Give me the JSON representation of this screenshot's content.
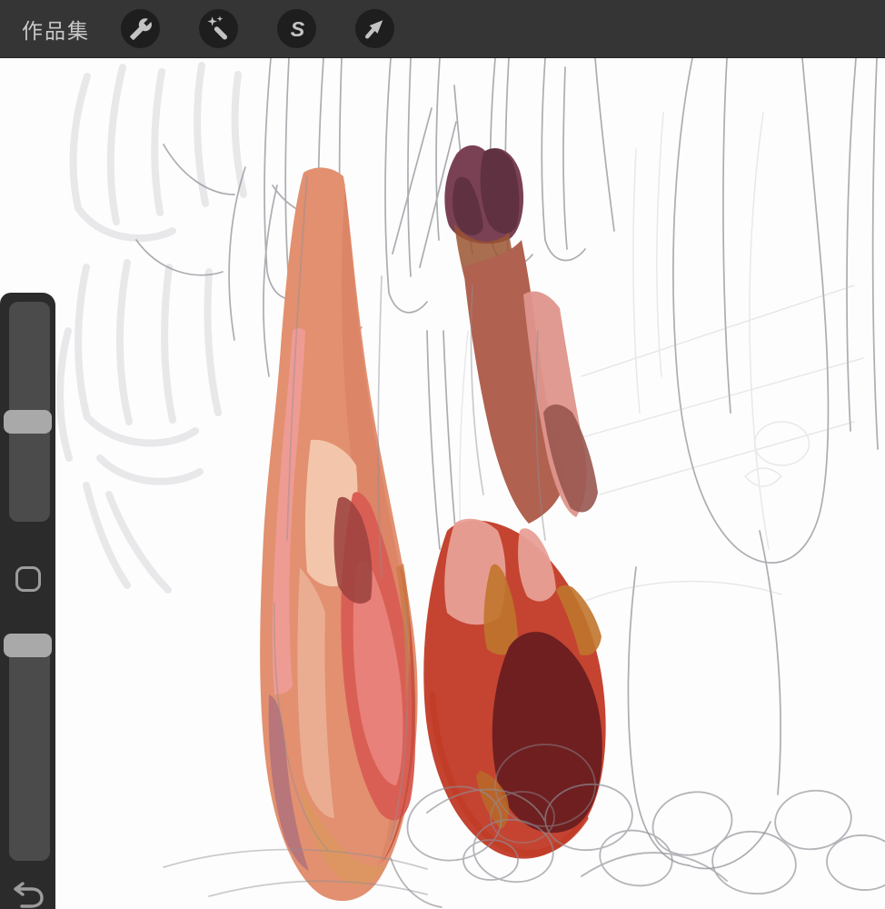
{
  "toolbar": {
    "gallery_label": "作品集",
    "selection_glyph": "S",
    "buttons": [
      {
        "name": "actions",
        "icon": "wrench-icon"
      },
      {
        "name": "adjustments",
        "icon": "magic-wand-icon"
      },
      {
        "name": "selection",
        "icon": "selection-s-icon"
      },
      {
        "name": "transform",
        "icon": "transform-arrow-icon"
      }
    ],
    "colors": {
      "bg": "#353536",
      "button_bg": "#1e1e1e",
      "icon": "#c3c3c3",
      "label": "#c9c9c9"
    }
  },
  "sidebar": {
    "sliders": [
      {
        "name": "brush-size",
        "handle_position_percent_from_top": 55
      },
      {
        "name": "opacity",
        "handle_position_percent_from_top": 0
      }
    ],
    "undo": {
      "icon": "undo-arrow-icon"
    },
    "modify": {
      "icon": "rounded-square-icon"
    },
    "colors": {
      "bg": "#2b2b2c",
      "track": "#4b4b4b",
      "handle": "#a9a9a9",
      "control": "#9c9c9c"
    }
  },
  "canvas": {
    "description": "Digital painting study of two hanging fuchsia flower buds — left bud salmon and coral with red core, right bud deep red with plum cap and dark maroon shadow — over a loose graphite pencil sketch of petals, hanging buds and scribbled loops",
    "background": "#fdfdfd",
    "palette": {
      "pencil": "#8e8e96",
      "pencil_soft": "#a8a8b0",
      "pencil_faint": "#b9b9c1",
      "bud1_base": "#e29070",
      "bud1_shade": "#d87f61",
      "bud1_pink": "#ef9c98",
      "bud1_highlight": "#f3c9ae",
      "bud1_highlight2": "#eeb9a0",
      "bud1_red": "#d95f55",
      "bud1_red_light": "#e8857d",
      "bud1_dark": "#9e4440",
      "bud1_edge": "#c14f3b",
      "bud1_orange": "#cd7a45",
      "bud1_mauve": "#a96e7e",
      "bud1_orange_bottom": "#dd9761",
      "bud2_plum": "#7a4154",
      "bud2_plum_dark": "#5d303f",
      "bud2_rust": "#9a5331",
      "bud2_neck": "#b06150",
      "bud2_pink": "#de958b",
      "bud2_mauve": "#98564f",
      "bud2_red": "#c44431",
      "bud2_pink_light": "#e8a096",
      "bud2_maroon": "#6f1f20",
      "bud2_orange": "#c0762e",
      "bud2_orange_dark": "#b86a28",
      "bud2_rim": "#c23d28"
    }
  }
}
